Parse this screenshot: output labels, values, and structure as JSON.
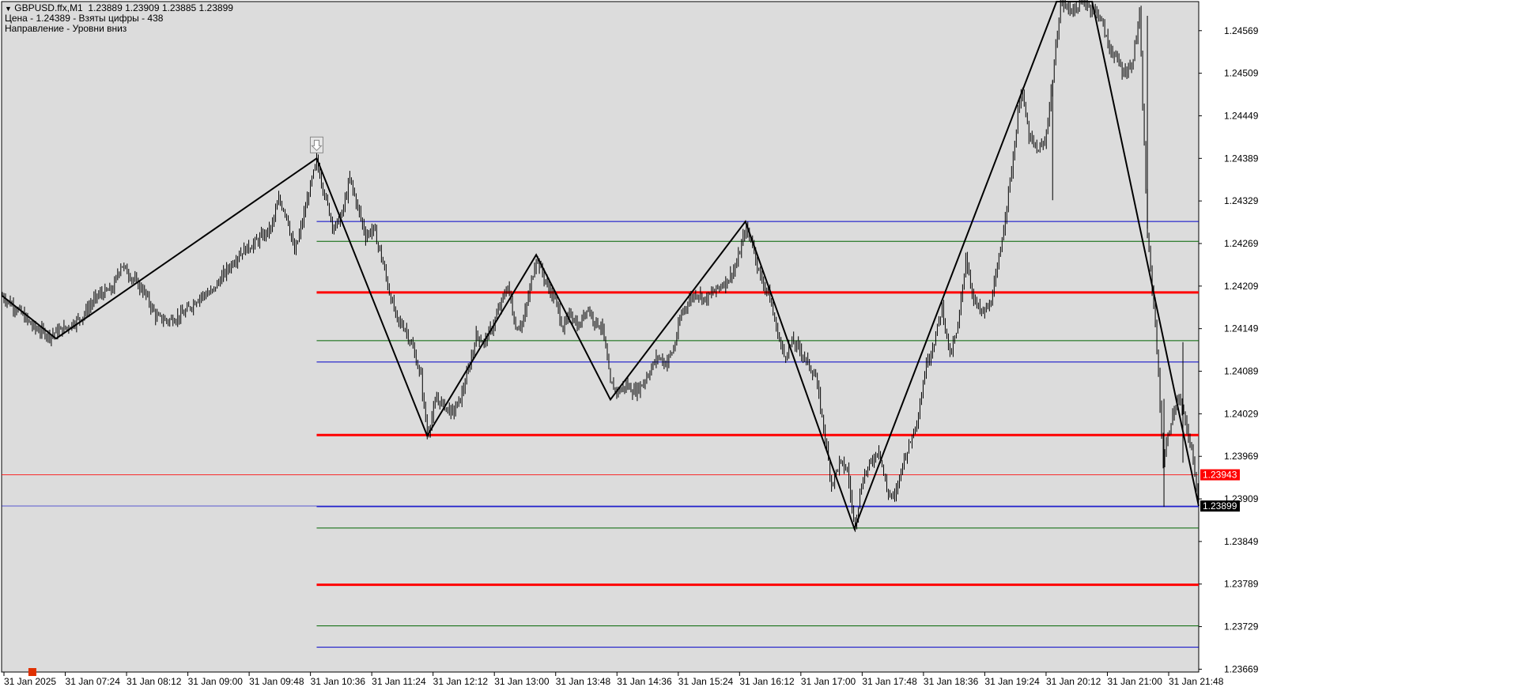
{
  "window": {
    "header_symbol": "GBPUSD.ffx,M1",
    "header_ohlc": "1.23889 1.23909 1.23885 1.23899",
    "info_price": "Цена - 1.24389 - Взяты цифры - 438",
    "info_direction": "Направление - Уровни вниз"
  },
  "colors": {
    "background": "#dcdcdc",
    "candle": "#000000",
    "zigzag": "#000000",
    "level_red": "#ff0000",
    "level_green": "#006400",
    "level_blue": "#0000c8",
    "marker": "#e03000"
  },
  "chart_data": {
    "type": "line",
    "title": "",
    "ylim": [
      1.23665,
      1.2461
    ],
    "y_ticks": [
      "1.24569",
      "1.24509",
      "1.24449",
      "1.24389",
      "1.24329",
      "1.24269",
      "1.24209",
      "1.24149",
      "1.24089",
      "1.24029",
      "1.23969",
      "1.23909",
      "1.23849",
      "1.23789",
      "1.23729",
      "1.23669"
    ],
    "x_ticks": [
      "31 Jan 2025",
      "31 Jan 07:24",
      "31 Jan 08:12",
      "31 Jan 09:00",
      "31 Jan 09:48",
      "31 Jan 10:36",
      "31 Jan 11:24",
      "31 Jan 12:12",
      "31 Jan 13:00",
      "31 Jan 13:48",
      "31 Jan 14:36",
      "31 Jan 15:24",
      "31 Jan 16:12",
      "31 Jan 17:00",
      "31 Jan 17:48",
      "31 Jan 18:36",
      "31 Jan 19:24",
      "31 Jan 20:12",
      "31 Jan 21:00",
      "31 Jan 21:48"
    ],
    "x_range": [
      0,
      1515
    ],
    "series": [
      {
        "kind": "price",
        "values": [
          [
            0,
            1.24195
          ],
          [
            20,
            1.24175
          ],
          [
            40,
            1.2415
          ],
          [
            60,
            1.2414
          ],
          [
            80,
            1.2415
          ],
          [
            100,
            1.24165
          ],
          [
            120,
            1.24195
          ],
          [
            140,
            1.24205
          ],
          [
            150,
            1.2424
          ],
          [
            165,
            1.2422
          ],
          [
            180,
            1.242
          ],
          [
            195,
            1.24165
          ],
          [
            210,
            1.2416
          ],
          [
            230,
            1.2417
          ],
          [
            250,
            1.24195
          ],
          [
            265,
            1.242
          ],
          [
            280,
            1.24225
          ],
          [
            300,
            1.24255
          ],
          [
            320,
            1.2427
          ],
          [
            340,
            1.2429
          ],
          [
            350,
            1.2433
          ],
          [
            360,
            1.2431
          ],
          [
            370,
            1.24255
          ],
          [
            380,
            1.243
          ],
          [
            390,
            1.2435
          ],
          [
            398,
            1.24385
          ],
          [
            410,
            1.2433
          ],
          [
            420,
            1.2429
          ],
          [
            430,
            1.2431
          ],
          [
            440,
            1.2436
          ],
          [
            450,
            1.2432
          ],
          [
            460,
            1.2428
          ],
          [
            470,
            1.2429
          ],
          [
            480,
            1.2425
          ],
          [
            490,
            1.242
          ],
          [
            500,
            1.2416
          ],
          [
            510,
            1.2415
          ],
          [
            520,
            1.2412
          ],
          [
            530,
            1.2408
          ],
          [
            538,
            1.24
          ],
          [
            550,
            1.2405
          ],
          [
            560,
            1.2404
          ],
          [
            570,
            1.2403
          ],
          [
            580,
            1.2405
          ],
          [
            590,
            1.2409
          ],
          [
            600,
            1.2414
          ],
          [
            610,
            1.2413
          ],
          [
            620,
            1.2415
          ],
          [
            630,
            1.2418
          ],
          [
            640,
            1.2421
          ],
          [
            650,
            1.2415
          ],
          [
            660,
            1.2416
          ],
          [
            676,
            1.2425
          ],
          [
            690,
            1.2421
          ],
          [
            700,
            1.2419
          ],
          [
            710,
            1.2415
          ],
          [
            720,
            1.2417
          ],
          [
            730,
            1.2415
          ],
          [
            740,
            1.2418
          ],
          [
            750,
            1.2416
          ],
          [
            760,
            1.2415
          ],
          [
            770,
            1.2407
          ],
          [
            780,
            1.2406
          ],
          [
            790,
            1.2407
          ],
          [
            800,
            1.2406
          ],
          [
            810,
            1.2407
          ],
          [
            820,
            1.2409
          ],
          [
            830,
            1.2411
          ],
          [
            840,
            1.241
          ],
          [
            850,
            1.2412
          ],
          [
            860,
            1.2417
          ],
          [
            870,
            1.2419
          ],
          [
            880,
            1.242
          ],
          [
            890,
            1.2419
          ],
          [
            900,
            1.242
          ],
          [
            910,
            1.2421
          ],
          [
            920,
            1.2422
          ],
          [
            930,
            1.2424
          ],
          [
            941,
            1.2429
          ],
          [
            950,
            1.2427
          ],
          [
            960,
            1.2422
          ],
          [
            970,
            1.242
          ],
          [
            980,
            1.2415
          ],
          [
            990,
            1.2411
          ],
          [
            1000,
            1.2413
          ],
          [
            1010,
            1.2412
          ],
          [
            1020,
            1.241
          ],
          [
            1030,
            1.2408
          ],
          [
            1040,
            1.2401
          ],
          [
            1050,
            1.2393
          ],
          [
            1060,
            1.2396
          ],
          [
            1070,
            1.2395
          ],
          [
            1079,
            1.2387
          ],
          [
            1090,
            1.2394
          ],
          [
            1100,
            1.2396
          ],
          [
            1110,
            1.2398
          ],
          [
            1120,
            1.2392
          ],
          [
            1130,
            1.2391
          ],
          [
            1140,
            1.2396
          ],
          [
            1150,
            1.2399
          ],
          [
            1160,
            1.2403
          ],
          [
            1170,
            1.241
          ],
          [
            1180,
            1.2413
          ],
          [
            1190,
            1.2418
          ],
          [
            1200,
            1.2411
          ],
          [
            1210,
            1.2415
          ],
          [
            1220,
            1.2425
          ],
          [
            1230,
            1.2419
          ],
          [
            1240,
            1.2417
          ],
          [
            1250,
            1.2418
          ],
          [
            1260,
            1.2423
          ],
          [
            1270,
            1.2431
          ],
          [
            1280,
            1.2439
          ],
          [
            1290,
            1.2449
          ],
          [
            1300,
            1.2442
          ],
          [
            1310,
            1.244
          ],
          [
            1320,
            1.2441
          ],
          [
            1330,
            1.245
          ],
          [
            1340,
            1.2461
          ],
          [
            1350,
            1.246
          ],
          [
            1360,
            1.246
          ],
          [
            1370,
            1.2461
          ],
          [
            1380,
            1.246
          ],
          [
            1390,
            1.2459
          ],
          [
            1400,
            1.2455
          ],
          [
            1410,
            1.2453
          ],
          [
            1420,
            1.2451
          ],
          [
            1430,
            1.2452
          ],
          [
            1440,
            1.2459
          ],
          [
            1450,
            1.2428
          ],
          [
            1460,
            1.2416
          ],
          [
            1470,
            1.2396
          ],
          [
            1480,
            1.2402
          ],
          [
            1490,
            1.2405
          ],
          [
            1500,
            1.2401
          ],
          [
            1510,
            1.2395
          ],
          [
            1515,
            1.23899
          ]
        ]
      },
      {
        "kind": "zigzag",
        "values": [
          [
            0,
            1.24195
          ],
          [
            68,
            1.24135
          ],
          [
            398,
            1.24389
          ],
          [
            538,
            1.23998
          ],
          [
            676,
            1.24253
          ],
          [
            770,
            1.24049
          ],
          [
            941,
            1.243
          ],
          [
            1079,
            1.23867
          ],
          [
            1335,
            1.2461
          ],
          [
            1380,
            1.2461
          ],
          [
            1515,
            1.23899
          ]
        ]
      }
    ],
    "levels": [
      {
        "price": 1.243,
        "color": "blue",
        "width": 1
      },
      {
        "price": 1.24272,
        "color": "green",
        "width": 1
      },
      {
        "price": 1.242,
        "color": "red",
        "width": 3
      },
      {
        "price": 1.24132,
        "color": "green",
        "width": 1
      },
      {
        "price": 1.24102,
        "color": "blue",
        "width": 1
      },
      {
        "price": 1.23999,
        "color": "red",
        "width": 3
      },
      {
        "price": 1.23898,
        "color": "blue",
        "width": 1
      },
      {
        "price": 1.23868,
        "color": "green",
        "width": 1
      },
      {
        "price": 1.23788,
        "color": "red",
        "width": 3
      },
      {
        "price": 1.2373,
        "color": "green",
        "width": 1
      },
      {
        "price": 1.237,
        "color": "blue",
        "width": 1
      }
    ],
    "levels_start_x": 398,
    "bid_line": {
      "price": 1.23943,
      "label": "1.23943",
      "color": "#ff0000"
    },
    "current_price": {
      "price": 1.23899,
      "label": "1.23899"
    },
    "sell_arrow_at": [
      398,
      1.24389
    ],
    "marker_at": [
      38,
      1.23665
    ]
  }
}
